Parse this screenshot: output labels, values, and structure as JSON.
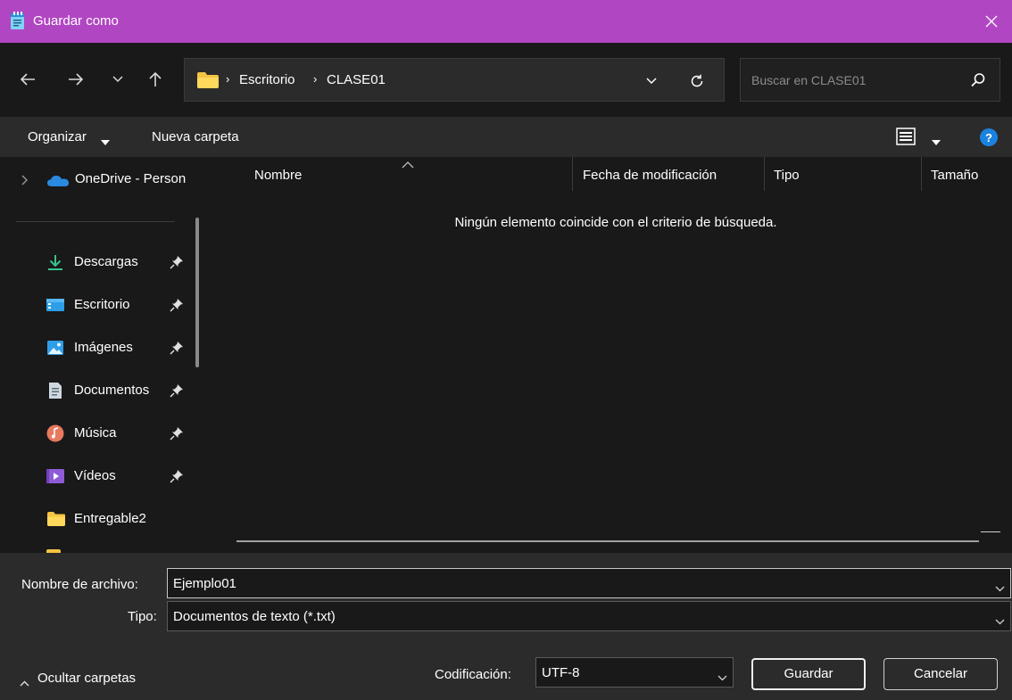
{
  "window": {
    "title": "Guardar como",
    "accent_color": "#b146c2",
    "icons": {
      "app": "notepad-icon",
      "close": "close-icon"
    }
  },
  "navigation": {
    "back_icon": "arrow-left-icon",
    "forward_icon": "arrow-right-icon",
    "recent_icon": "chevron-down-icon",
    "up_icon": "arrow-up-icon",
    "breadcrumb": [
      "Escritorio",
      "CLASE01"
    ],
    "refresh_icon": "refresh-icon",
    "search_placeholder": "Buscar en CLASE01"
  },
  "commandbar": {
    "organize_label": "Organizar",
    "new_folder_label": "Nueva carpeta",
    "view_icon": "view-details-icon",
    "help_label": "?"
  },
  "sidebar": {
    "onedrive_label": "OneDrive - Personal",
    "items": [
      {
        "label": "Descargas",
        "icon": "download-icon",
        "pinned": true
      },
      {
        "label": "Escritorio",
        "icon": "desktop-icon",
        "pinned": true
      },
      {
        "label": "Imágenes",
        "icon": "pictures-icon",
        "pinned": true
      },
      {
        "label": "Documentos",
        "icon": "documents-icon",
        "pinned": true
      },
      {
        "label": "Música",
        "icon": "music-icon",
        "pinned": true
      },
      {
        "label": "Vídeos",
        "icon": "videos-icon",
        "pinned": true
      },
      {
        "label": "Entregable2",
        "icon": "folder-icon",
        "pinned": false
      }
    ]
  },
  "filelist": {
    "columns": [
      "Nombre",
      "Fecha de modificación",
      "Tipo",
      "Tamaño"
    ],
    "empty_message": "Ningún elemento coincide con el criterio de búsqueda."
  },
  "form": {
    "filename_label": "Nombre de archivo:",
    "filename_value": "Ejemplo01",
    "type_label": "Tipo:",
    "type_value": "Documentos de texto (*.txt)",
    "encoding_label": "Codificación:",
    "encoding_value": "UTF-8",
    "save_label": "Guardar",
    "cancel_label": "Cancelar",
    "hide_folders_label": "Ocultar carpetas"
  }
}
